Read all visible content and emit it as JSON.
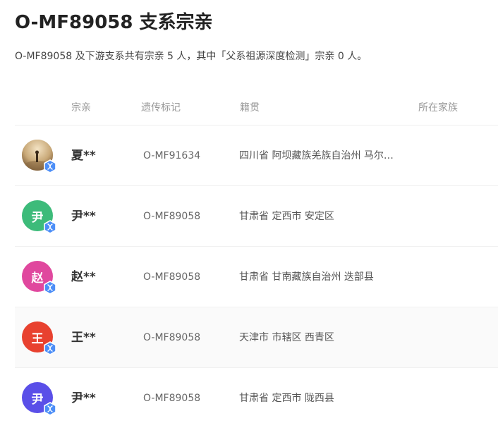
{
  "header": {
    "title": "O-MF89058 支系宗亲",
    "subtitle": "O-MF89058 及下游支系共有宗亲 5 人，其中「父系祖源深度检测」宗亲 0 人。"
  },
  "table": {
    "columns": {
      "relative": "宗亲",
      "genetic_marker": "遗传标记",
      "origin": "籍贯",
      "family": "所在家族"
    },
    "rows": [
      {
        "avatar_char": "",
        "avatar_type": "photo",
        "avatar_color": "#c9a978",
        "name": "夏**",
        "marker": "O-MF91634",
        "origin": "四川省 阿坝藏族羌族自治州 马尔康市",
        "family": "",
        "shaded": false
      },
      {
        "avatar_char": "尹",
        "avatar_type": "letter",
        "avatar_color": "#3dbb7a",
        "name": "尹**",
        "marker": "O-MF89058",
        "origin": "甘肃省 定西市 安定区",
        "family": "",
        "shaded": false
      },
      {
        "avatar_char": "赵",
        "avatar_type": "letter",
        "avatar_color": "#e0489e",
        "name": "赵**",
        "marker": "O-MF89058",
        "origin": "甘肃省 甘南藏族自治州 迭部县",
        "family": "",
        "shaded": false
      },
      {
        "avatar_char": "王",
        "avatar_type": "letter",
        "avatar_color": "#e8412f",
        "name": "王**",
        "marker": "O-MF89058",
        "origin": "天津市 市辖区 西青区",
        "family": "",
        "shaded": true
      },
      {
        "avatar_char": "尹",
        "avatar_type": "letter",
        "avatar_color": "#5a4fe8",
        "name": "尹**",
        "marker": "O-MF89058",
        "origin": "甘肃省 定西市 陇西县",
        "family": "",
        "shaded": false
      }
    ]
  },
  "colors": {
    "badge": "#4c8ef7",
    "badge_border": "#ffffff"
  },
  "icons": {
    "badge": "dna-verified-icon"
  }
}
